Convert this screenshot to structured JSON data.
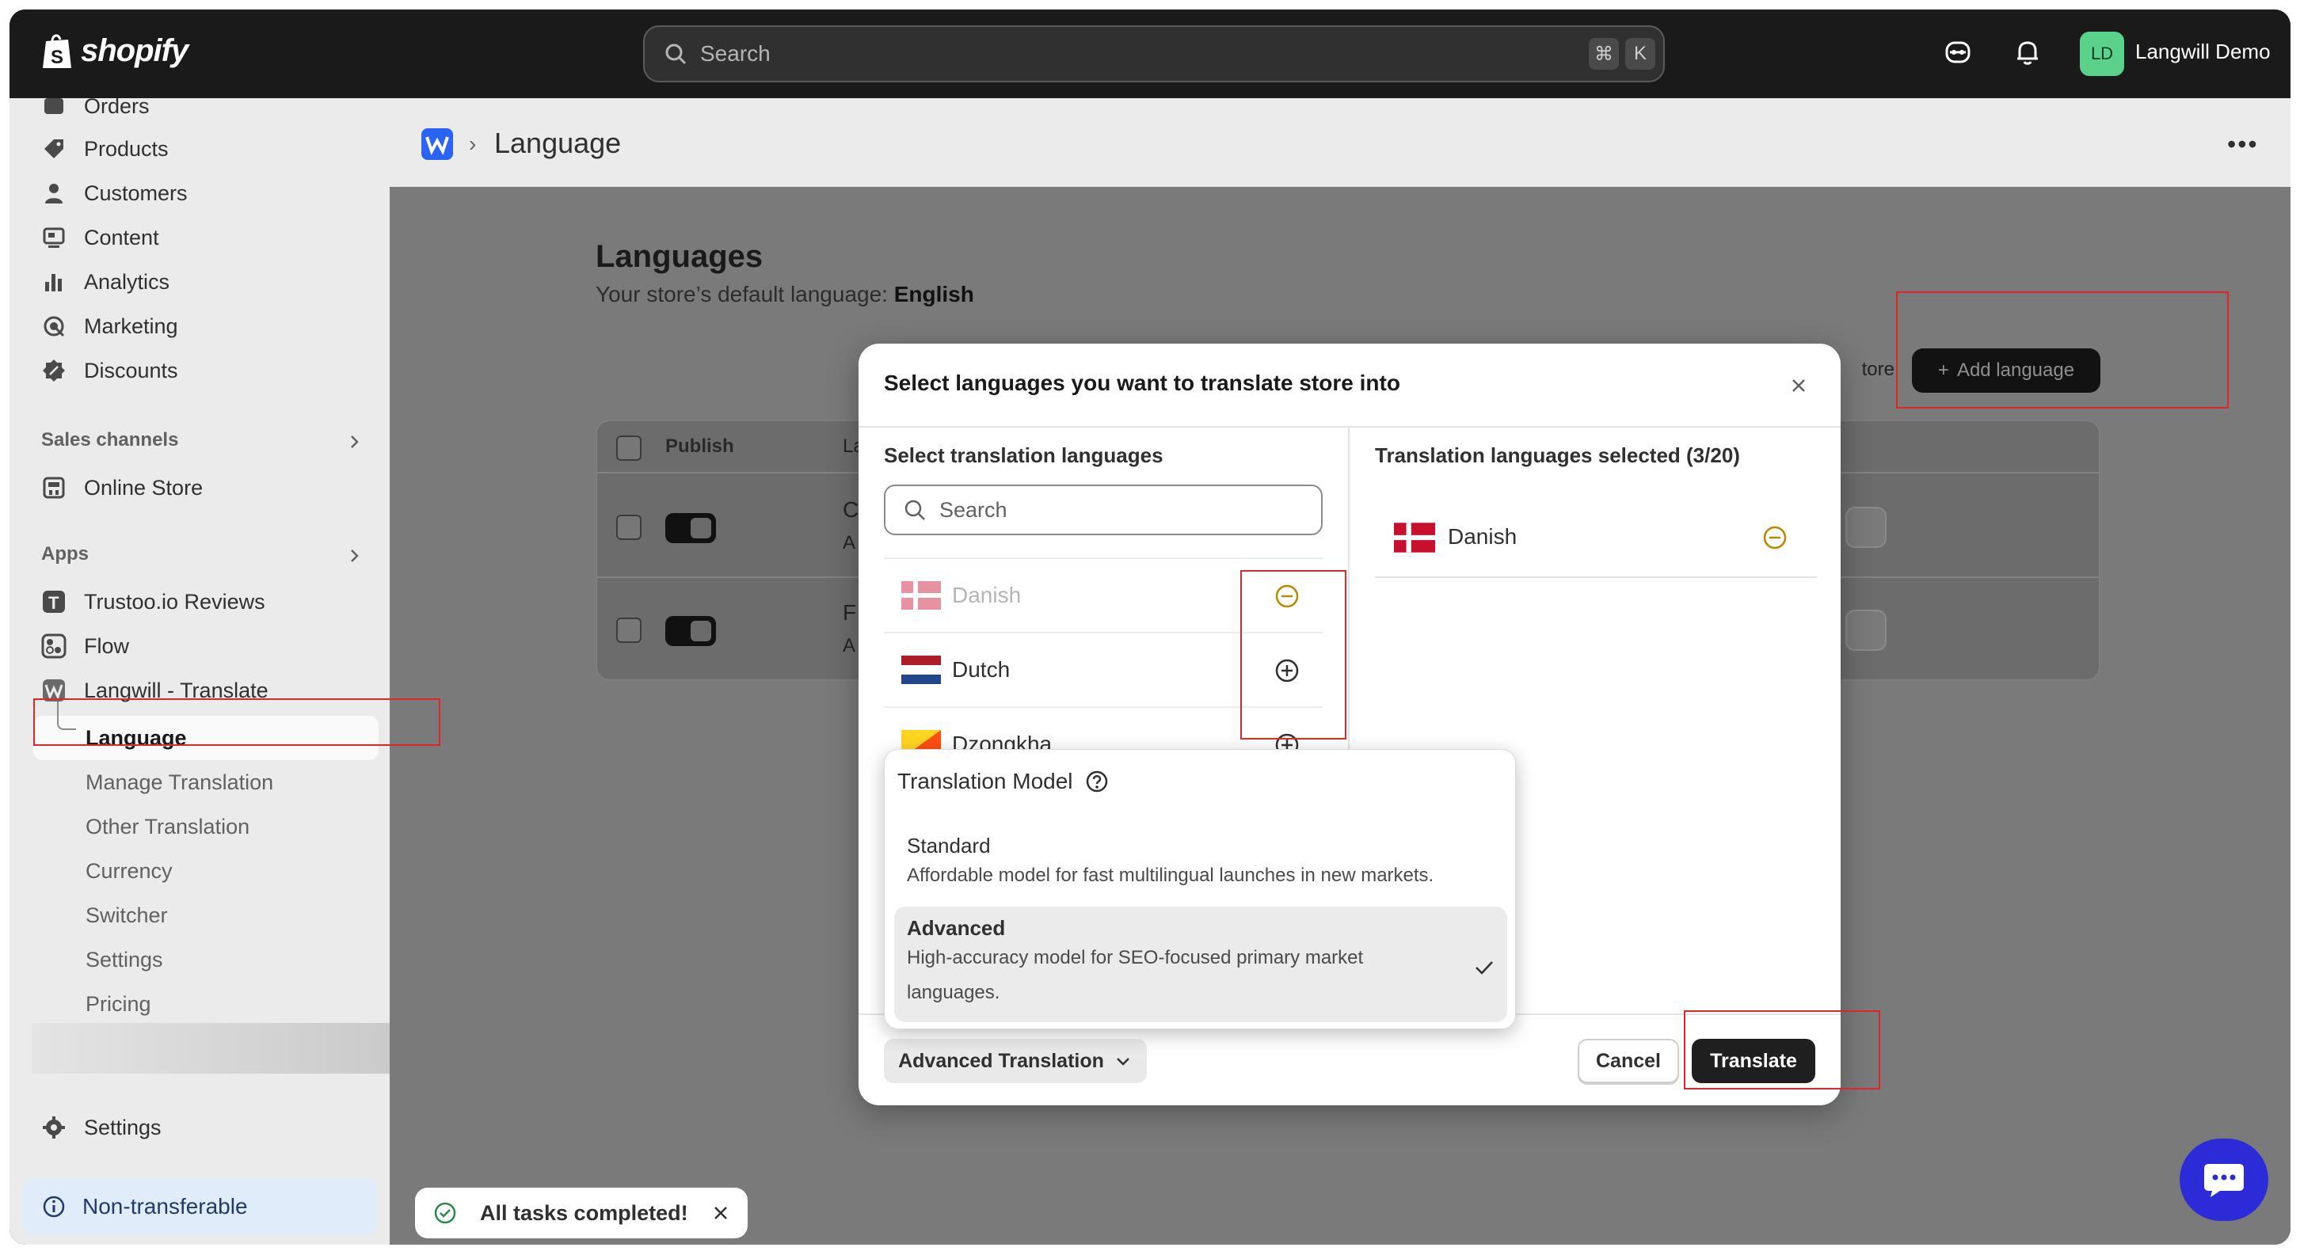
{
  "topbar": {
    "brand": "shopify",
    "search_placeholder": "Search",
    "shortcut_cmd": "⌘",
    "shortcut_key": "K",
    "avatar_initials": "LD",
    "store_name": "Langwill Demo"
  },
  "sidebar": {
    "items": [
      {
        "label": "Orders"
      },
      {
        "label": "Products"
      },
      {
        "label": "Customers"
      },
      {
        "label": "Content"
      },
      {
        "label": "Analytics"
      },
      {
        "label": "Marketing"
      },
      {
        "label": "Discounts"
      }
    ],
    "sales_channels_label": "Sales channels",
    "online_store": "Online Store",
    "apps_label": "Apps",
    "apps": [
      {
        "label": "Trustoo.io Reviews"
      },
      {
        "label": "Flow"
      },
      {
        "label": "Langwill - Translate"
      }
    ],
    "app_subitems": [
      {
        "label": "Language"
      },
      {
        "label": "Manage Translation"
      },
      {
        "label": "Other Translation"
      },
      {
        "label": "Currency"
      },
      {
        "label": "Switcher"
      },
      {
        "label": "Settings"
      },
      {
        "label": "Pricing"
      }
    ],
    "settings": "Settings",
    "non_transferable": "Non-transferable"
  },
  "page": {
    "title": "Language",
    "languages_heading": "Languages",
    "default_prefix": "Your store’s default language: ",
    "default_language": "English",
    "table_publish": "Publish",
    "table_lang_partial": "La",
    "row1_partial": "C",
    "row1_sub_partial": "A",
    "row2_partial": "F",
    "row2_sub_partial": "A",
    "store_btn_partial": "tore",
    "add_language": "Add language"
  },
  "modal": {
    "title": "Select languages you want to translate store into",
    "left_title": "Select translation languages",
    "search_placeholder": "Search",
    "languages": [
      {
        "name": "Danish",
        "state": "selected"
      },
      {
        "name": "Dutch",
        "state": "available"
      },
      {
        "name": "Dzongkha",
        "state": "available"
      }
    ],
    "right_title": "Translation languages selected (3/20)",
    "selected": [
      {
        "name": "Danish"
      }
    ],
    "advanced_btn": "Advanced Translation",
    "cancel": "Cancel",
    "translate": "Translate"
  },
  "popover": {
    "title": "Translation Model",
    "options": [
      {
        "name": "Standard",
        "desc": "Affordable model for fast multilingual launches in new markets.",
        "selected": false
      },
      {
        "name": "Advanced",
        "desc": "High-accuracy model for SEO-focused primary market languages.",
        "selected": true
      }
    ]
  },
  "toast": {
    "message": "All tasks completed!"
  },
  "colors": {
    "accent_orange": "#b98900",
    "primary_dark": "#1f1f1f",
    "annotation_red": "#e0262a"
  }
}
